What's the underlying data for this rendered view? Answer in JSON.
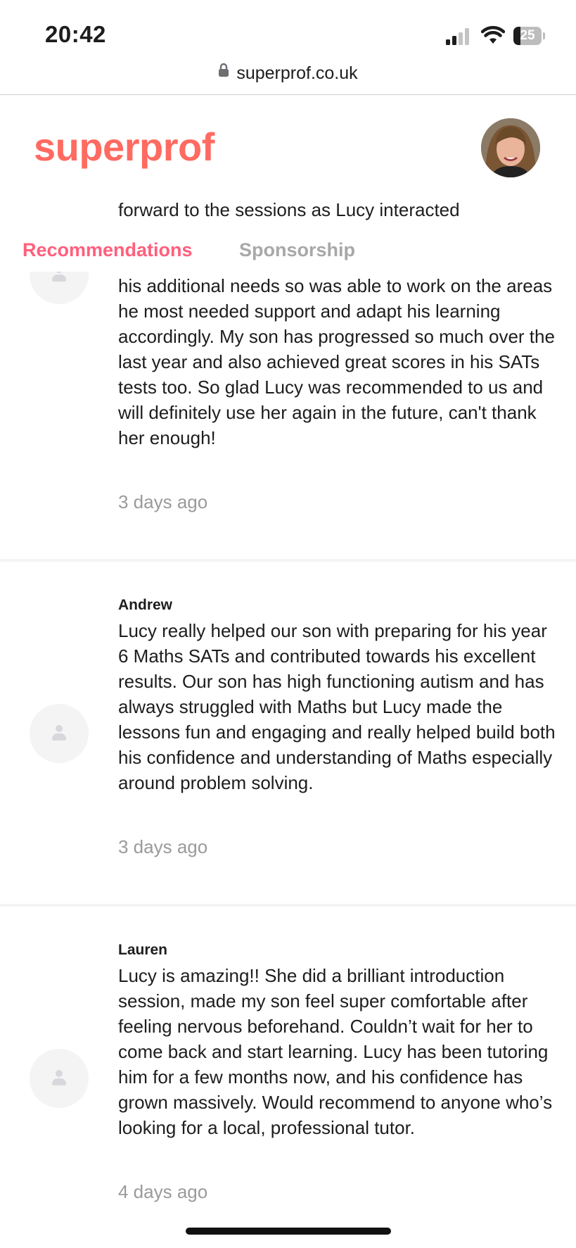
{
  "status_bar": {
    "time": "20:42",
    "battery_level": "25",
    "icons": [
      "signal-icon",
      "wifi-icon",
      "battery-icon"
    ]
  },
  "browser": {
    "url": "superprof.co.uk",
    "lock_icon": "lock-icon"
  },
  "header": {
    "logo_text": "superprof",
    "logo_color": "#ff6a61"
  },
  "clipped_review_line": "forward to the sessions as Lucy interacted",
  "tabs": [
    {
      "label": "Recommendations",
      "active": true,
      "color": "#ff5f7c"
    },
    {
      "label": "Sponsorship",
      "active": false,
      "color": "#a8a8a8"
    }
  ],
  "reviews": [
    {
      "author": "",
      "text": "his additional needs so was able to work on the areas he most needed support and adapt his learning accordingly. My son has progressed so much over the last year and also achieved great scores in his SATs tests too. So glad Lucy was recommended to us and will definitely use her again in the future, can't thank her enough!",
      "date": "3 days ago"
    },
    {
      "author": "Andrew",
      "text": "Lucy really helped our son with preparing for his year 6 Maths SATs and contributed towards his excellent results. Our son has high functioning autism and has always struggled with Maths but Lucy made the lessons fun and engaging and really helped build both his confidence and understanding of Maths especially around problem solving.",
      "date": "3 days ago"
    },
    {
      "author": "Lauren",
      "text": "Lucy is amazing!! She did a brilliant introduction session, made my son feel super comfortable after feeling nervous beforehand. Couldn’t wait for her to come back and start learning. Lucy has been tutoring him for a few months now, and his confidence has grown massively. Would recommend to anyone who’s looking for a local, professional tutor.",
      "date": "4 days ago"
    }
  ]
}
